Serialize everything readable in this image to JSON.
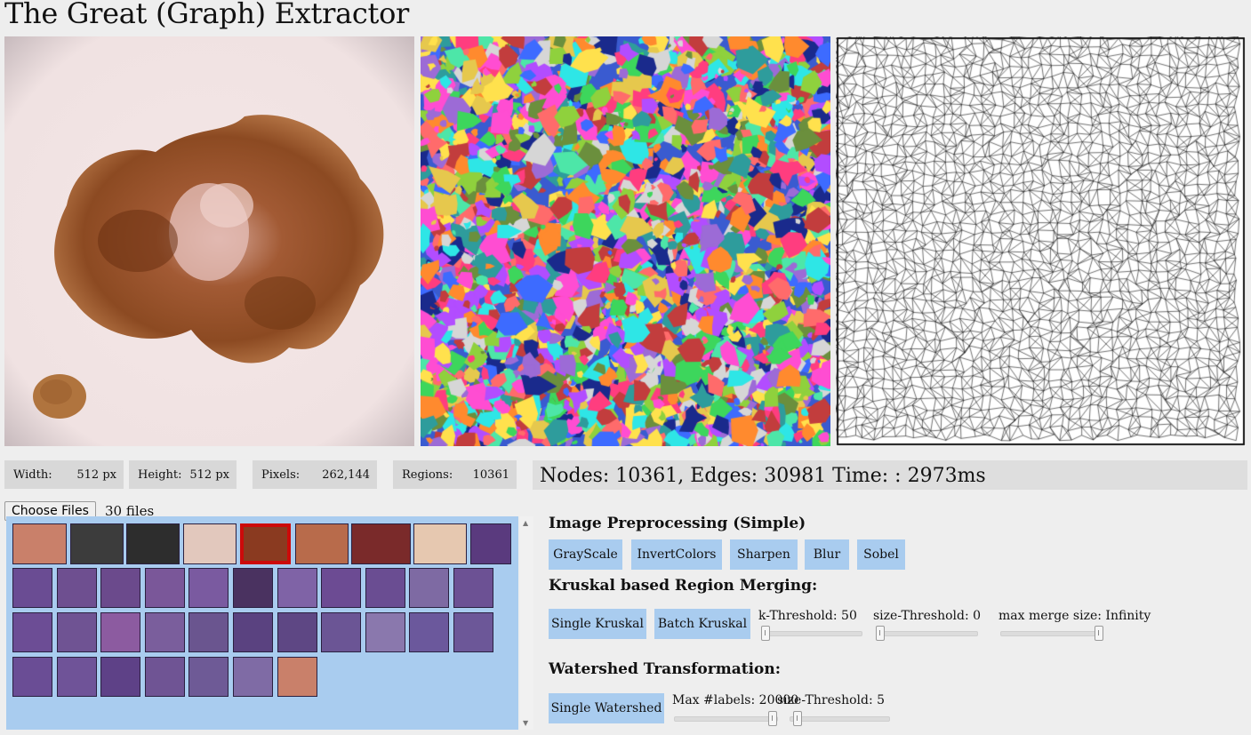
{
  "title": "The Great (Graph) Extractor",
  "icons": {
    "original_image": "original-image",
    "segmentation_image": "segmentation-image",
    "graph_image": "graph-image"
  },
  "stats": {
    "width_label": "Width:",
    "width_value": "512 px",
    "height_label": "Height:",
    "height_value": "512 px",
    "pixels_label": "Pixels:",
    "pixels_value": "262,144",
    "regions_label": "Regions:",
    "regions_value": "10361"
  },
  "summary": "Nodes: 10361, Edges: 30981 Time: : 2973ms",
  "files": {
    "choose_label": "Choose Files",
    "count": "30 files",
    "selected_index": 4,
    "thumb_colors": [
      "#c9806a",
      "#3c3c3c",
      "#2d2d2d",
      "#e2c8bd",
      "#8a3a20",
      "#b86b4b",
      "#7a2a2a",
      "#e6c8b0",
      "#5a3a7e",
      "#6a4c93",
      "#6e4f90",
      "#6b4a8c",
      "#7a5799",
      "#7a5aa0",
      "#4a3260",
      "#7f63a6",
      "#6c4b93",
      "#6a4d92",
      "#7e6aa3",
      "#6c5194",
      "#6c4d95",
      "#6f5393",
      "#8c5ba0",
      "#7a5e9c",
      "#6a558f",
      "#5a4280",
      "#5e4784",
      "#6b5595",
      "#8a78ad",
      "#6b589c",
      "#6c5798",
      "#6a4d95",
      "#6f5398",
      "#5e4187",
      "#6f5494",
      "#6e5a96",
      "#7f6ba5"
    ]
  },
  "preprocessing": {
    "heading": "Image Preprocessing (Simple)",
    "buttons": [
      "GrayScale",
      "InvertColors",
      "Sharpen",
      "Blur",
      "Sobel"
    ]
  },
  "kruskal": {
    "heading": "Kruskal based Region Merging:",
    "single_label": "Single Kruskal",
    "batch_label": "Batch Kruskal",
    "k_threshold_label": "k-Threshold: 50",
    "size_threshold_label": "size-Threshold: 0",
    "max_merge_label": "max merge size: Infinity"
  },
  "watershed": {
    "heading": "Watershed Transformation:",
    "single_label": "Single Watershed",
    "max_labels_label": "Max #labels: 20000",
    "size_threshold_label": "size-Threshold: 5"
  }
}
